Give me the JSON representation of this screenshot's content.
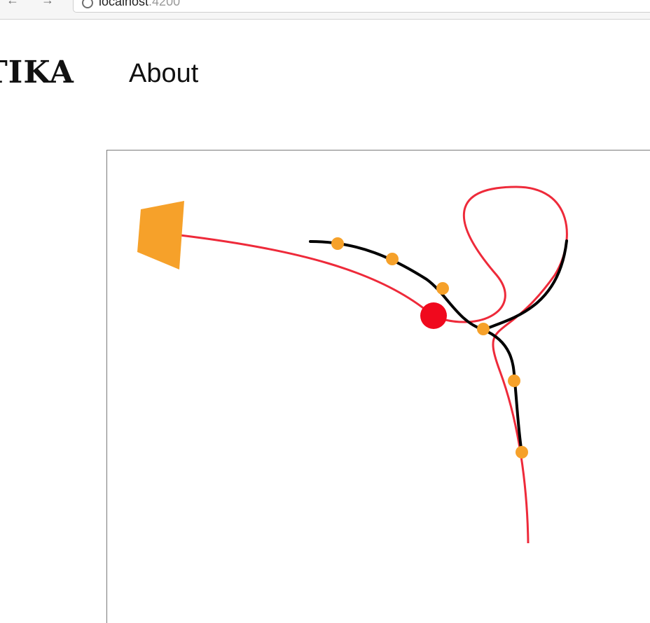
{
  "browser": {
    "url_host": "localhost",
    "url_port": ":4200",
    "icons": {
      "back": "arrow-left-icon",
      "forward": "arrow-right-icon",
      "site_info": "info-circle-icon"
    }
  },
  "site": {
    "brand": "TIKA",
    "nav": {
      "about": "About"
    }
  },
  "canvas": {
    "colors": {
      "guide_path": "#ee2a3a",
      "trajectory": "#000000",
      "waypoint": "#f6a12a",
      "agent": "#f0091d",
      "goal": "#f6a12a"
    }
  }
}
